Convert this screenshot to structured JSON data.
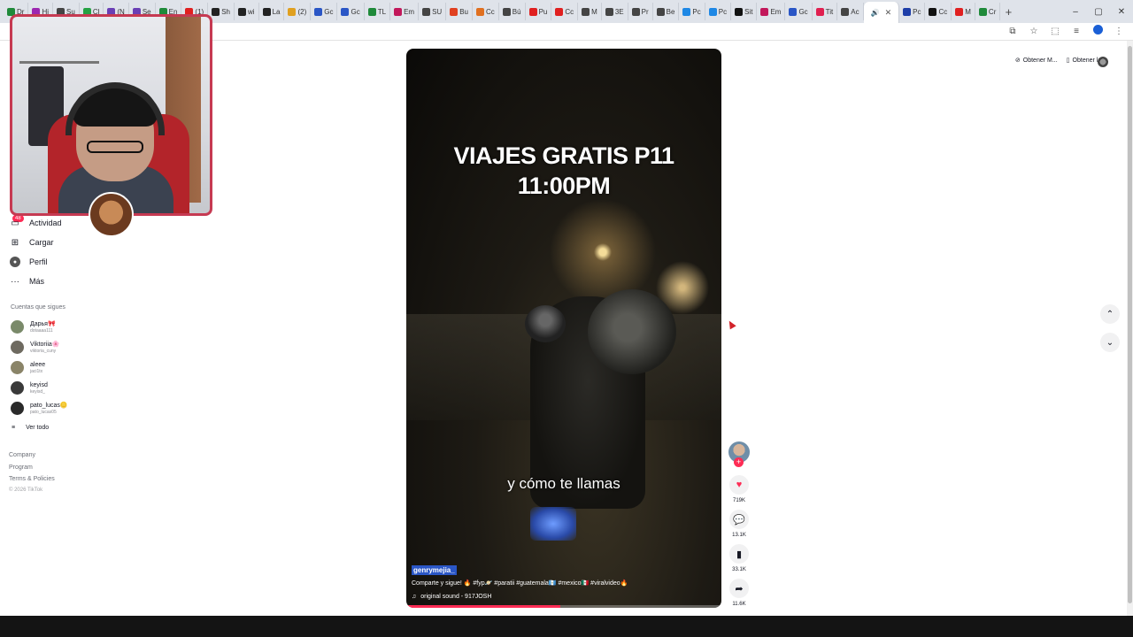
{
  "browser": {
    "tabs": [
      {
        "label": "Dr",
        "color": "#1f8a3a"
      },
      {
        "label": "Hi",
        "color": "#9c27b0"
      },
      {
        "label": "Su",
        "color": "#444444"
      },
      {
        "label": "Cl",
        "color": "#25a244"
      },
      {
        "label": "(N",
        "color": "#6a3fb5"
      },
      {
        "label": "Se",
        "color": "#6a3fb5"
      },
      {
        "label": "En",
        "color": "#1f8a3a"
      },
      {
        "label": "(1)",
        "color": "#e02020"
      },
      {
        "label": "Sh",
        "color": "#222222"
      },
      {
        "label": "wi",
        "color": "#222222"
      },
      {
        "label": "La",
        "color": "#222222"
      },
      {
        "label": "(2)",
        "color": "#e0a020"
      },
      {
        "label": "Gc",
        "color": "#2a56c6"
      },
      {
        "label": "Gc",
        "color": "#2a56c6"
      },
      {
        "label": "TL",
        "color": "#1f8a3a"
      },
      {
        "label": "Em",
        "color": "#c2185b"
      },
      {
        "label": "SU",
        "color": "#444444"
      },
      {
        "label": "Bu",
        "color": "#e04020"
      },
      {
        "label": "Cc",
        "color": "#e07020"
      },
      {
        "label": "Bú",
        "color": "#444444"
      },
      {
        "label": "Pu",
        "color": "#e02020"
      },
      {
        "label": "Cc",
        "color": "#e02020"
      },
      {
        "label": "M",
        "color": "#444444"
      },
      {
        "label": "3E",
        "color": "#444444"
      },
      {
        "label": "Pr",
        "color": "#444444"
      },
      {
        "label": "Be",
        "color": "#444444"
      },
      {
        "label": "Pc",
        "color": "#1e88e5"
      },
      {
        "label": "Pc",
        "color": "#1e88e5"
      },
      {
        "label": "Sit",
        "color": "#111111"
      },
      {
        "label": "Em",
        "color": "#c2185b"
      },
      {
        "label": "Gc",
        "color": "#2a56c6"
      },
      {
        "label": "Tit",
        "color": "#e02050"
      },
      {
        "label": "Ac",
        "color": "#444444"
      }
    ],
    "tabs_after": [
      {
        "label": "Pc",
        "color": "#1e3ea8"
      },
      {
        "label": "Cc",
        "color": "#111111"
      },
      {
        "label": "M",
        "color": "#e02020"
      },
      {
        "label": "Cr",
        "color": "#1f8a3a"
      }
    ],
    "new_tab": "+",
    "window_controls": {
      "minimize": "–",
      "maximize": "▢",
      "close": "✕"
    }
  },
  "sidebar": {
    "items": [
      {
        "label": "Actividad",
        "icon": "inbox-icon",
        "badge": "48"
      },
      {
        "label": "Cargar",
        "icon": "upload-icon"
      },
      {
        "label": "Perfil",
        "icon": "profile-avatar-icon"
      },
      {
        "label": "Más",
        "icon": "more-dots-icon"
      }
    ],
    "following_title": "Cuentas que sigues",
    "following": [
      {
        "name": "Дарья",
        "badge_text": "🎀",
        "username": "dotaaaa111",
        "avatar_color": "#7a8a6a"
      },
      {
        "name": "Viktoriia",
        "badge_text": "🌸",
        "username": "viktoria_cuny",
        "avatar_color": "#6e6a60"
      },
      {
        "name": "aleee",
        "badge_text": "",
        "username": "jaci1tx",
        "avatar_color": "#8a8468"
      },
      {
        "name": "keyisd",
        "badge_text": "",
        "username": "keyisd_",
        "avatar_color": "#3a3a3a"
      },
      {
        "name": "pato_lucas",
        "badge_text": "🪙",
        "username": "pato_lucas05",
        "avatar_color": "#2a2a2a"
      }
    ],
    "see_all": "Ver todo",
    "footer_links": [
      "Company",
      "Program",
      "Terms & Policies"
    ],
    "copyright": "© 2026 TikTok"
  },
  "video": {
    "title_line1": "VIAJES GRATIS P11",
    "title_line2": "11:00PM",
    "subtitle": "y cómo te llamas",
    "username": "genrymejia_",
    "caption": "Comparte y sigue! 🔥 #fyp🪐 #paratii #guatemala🇬🇹 #mexico🇲🇽 #viralvideo🔥",
    "sound": "original sound - 917JOSH",
    "progress": 0.49
  },
  "actions": {
    "likes": "719K",
    "comments": "13.1K",
    "saves": "33.1K",
    "shares": "11.6K"
  },
  "top_right": {
    "get_app_label": "Obtener M...",
    "get_app2_label": "Obtener la ..."
  },
  "nav": {
    "up": "⌃",
    "down": "⌄"
  }
}
